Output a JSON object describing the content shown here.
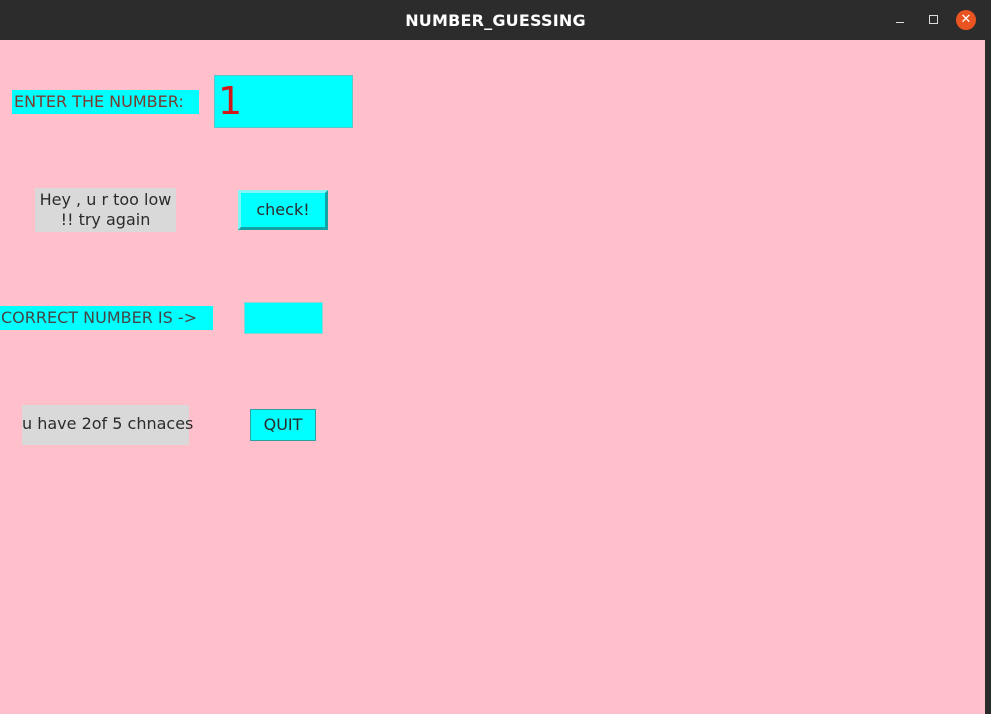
{
  "window": {
    "title": "NUMBER_GUESSING"
  },
  "form": {
    "enter_label": "ENTER THE NUMBER:",
    "entry_value": "1",
    "message": "Hey , u r too low\n!! try again",
    "check_button": "check!",
    "correct_label": "CORRECT NUMBER IS ->",
    "correct_value": "",
    "chances_text": "u have 2of 5 chnaces",
    "quit_button": "QUIT"
  },
  "colors": {
    "background": "#ffc0cb",
    "widget": "#00ffff",
    "message_bg": "#d9d9d9",
    "entry_text": "#d01818",
    "close_button": "#e95420",
    "titlebar": "#2c2c2c"
  },
  "icons": {
    "minimize": "minimize-icon",
    "maximize": "maximize-icon",
    "close": "close-icon"
  }
}
